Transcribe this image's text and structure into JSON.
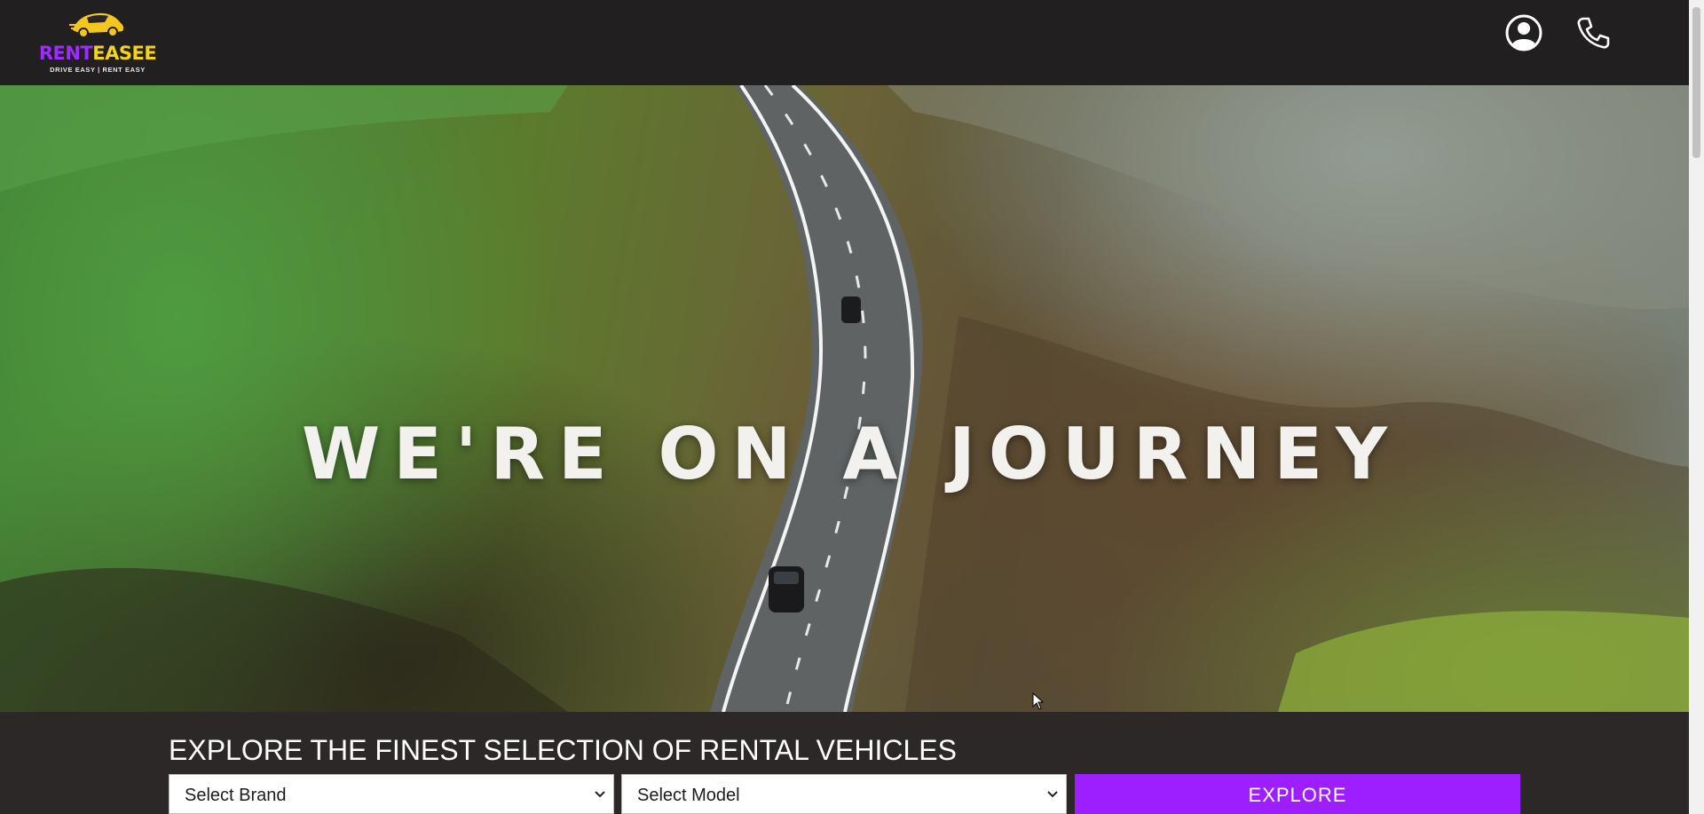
{
  "header": {
    "logo": {
      "word_part1": "RENT",
      "word_part2": "EASEE",
      "tagline": "DRIVE EASY | RENT EASY",
      "icon": "car-logo-icon"
    },
    "account_icon": "user-circle-icon",
    "phone_icon": "phone-icon"
  },
  "hero": {
    "title": "WE'RE ON A JOURNEY"
  },
  "explore": {
    "heading": "EXPLORE THE FINEST SELECTION OF RENTAL VEHICLES",
    "brand_select": {
      "selected": "Select Brand"
    },
    "model_select": {
      "selected": "Select Model"
    },
    "button_label": "EXPLORE"
  },
  "colors": {
    "brand_purple": "#9d1eff",
    "brand_yellow": "#f4d320",
    "header_bg": "#211f1f",
    "panel_bg": "#2d2828"
  }
}
